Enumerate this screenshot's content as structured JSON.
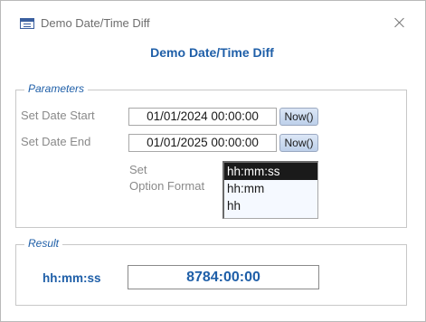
{
  "window": {
    "title": "Demo Date/Time Diff",
    "app_icon": "form-icon",
    "close_icon": "close-icon"
  },
  "header": {
    "title": "Demo Date/Time Diff"
  },
  "parameters": {
    "legend": "Parameters",
    "date_start": {
      "label": "Set Date Start",
      "value": "01/01/2024 00:00:00",
      "button": "Now()"
    },
    "date_end": {
      "label": "Set Date End",
      "value": "01/01/2025 00:00:00",
      "button": "Now()"
    },
    "option_format": {
      "label_line1": "Set",
      "label_line2": "Option Format",
      "options": [
        "hh:mm:ss",
        "hh:mm",
        "hh"
      ],
      "selected": "hh:mm:ss"
    }
  },
  "result": {
    "legend": "Result",
    "format_label": "hh:mm:ss",
    "value": "8784:00:00"
  },
  "colors": {
    "accent": "#1f5fa8",
    "label_gray": "#8a8a8a",
    "selected_bg": "#1a1a1a"
  }
}
